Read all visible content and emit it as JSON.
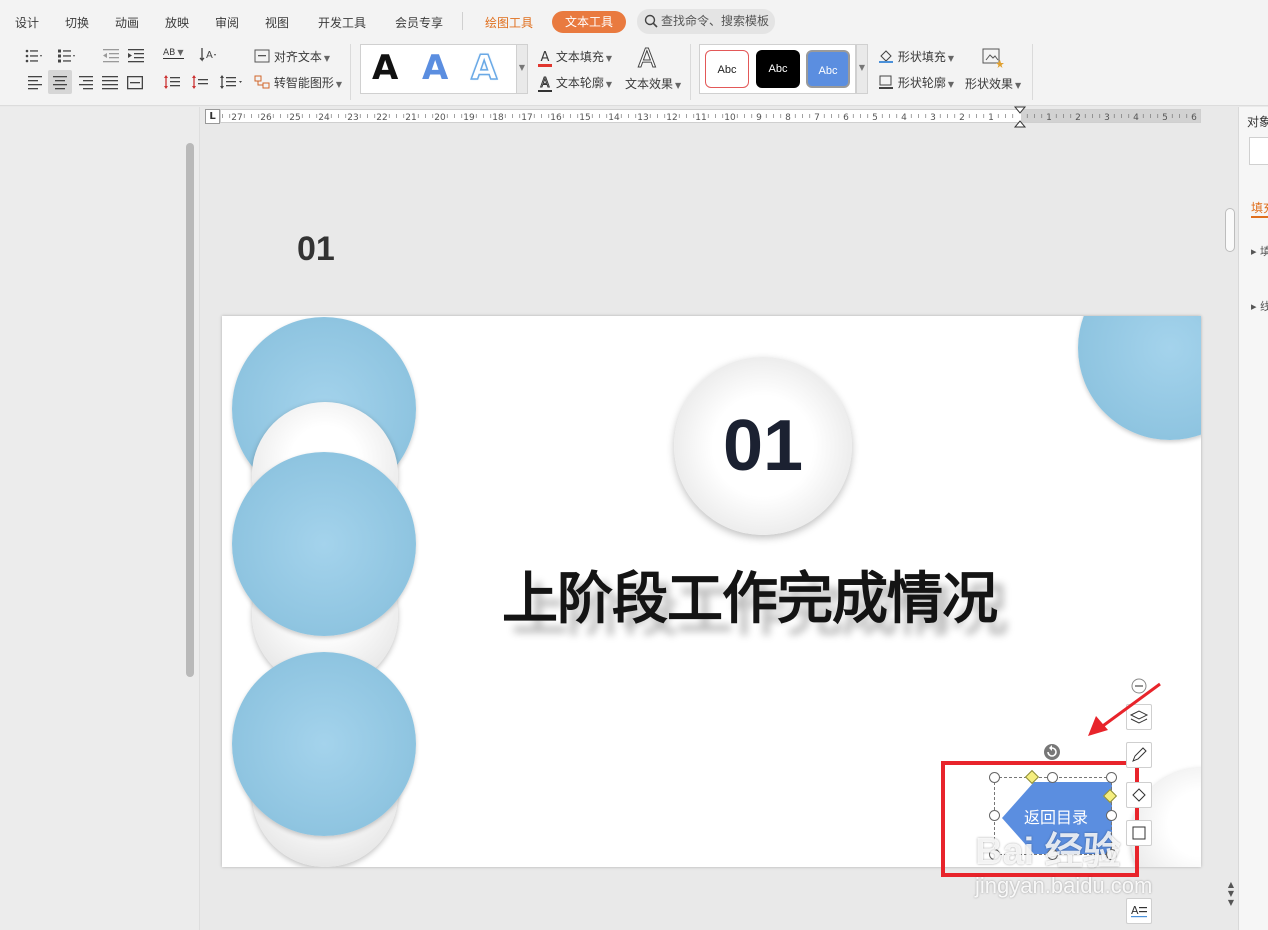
{
  "menubar": {
    "items": [
      "设计",
      "切换",
      "动画",
      "放映",
      "审阅",
      "视图",
      "开发工具",
      "会员专享"
    ],
    "drawing_tools": "绘图工具",
    "text_tools": "文本工具",
    "search_placeholder": "查找命令、搜索模板"
  },
  "ribbon": {
    "align_text": "对齐文本",
    "smart_shape": "转智能图形",
    "text_fill": "文本填充",
    "text_outline": "文本轮廓",
    "text_effect": "文本效果",
    "shape_fill": "形状填充",
    "shape_outline": "形状轮廓",
    "shape_effect": "形状效果",
    "wordart_letter": "A",
    "shape_style_sample": "Abc",
    "ab_label": "AB"
  },
  "ruler": {
    "ticks": [
      "27",
      "26",
      "25",
      "24",
      "23",
      "22",
      "21",
      "20",
      "19",
      "18",
      "17",
      "16",
      "15",
      "14",
      "13",
      "12",
      "11",
      "10",
      "9",
      "8",
      "7",
      "6",
      "5",
      "4",
      "3",
      "2",
      "1",
      "",
      "1",
      "2",
      "3",
      "4",
      "5",
      "6"
    ]
  },
  "right_pane": {
    "title_partial": "对象",
    "tab_partial": "填充",
    "item1": "填",
    "item2": "线"
  },
  "slide": {
    "thumbnail_number": "01",
    "section_number": "01",
    "section_title": "上阶段工作完成情况",
    "return_button": "返回目录"
  },
  "watermark": {
    "main": "Bai 经验",
    "sub": "jingyan.baidu.com"
  },
  "colors": {
    "accent_orange": "#e97a3f",
    "bubble_blue": "#8ec4e0",
    "button_blue": "#5b8ee0",
    "highlight_red": "#e8242b"
  }
}
